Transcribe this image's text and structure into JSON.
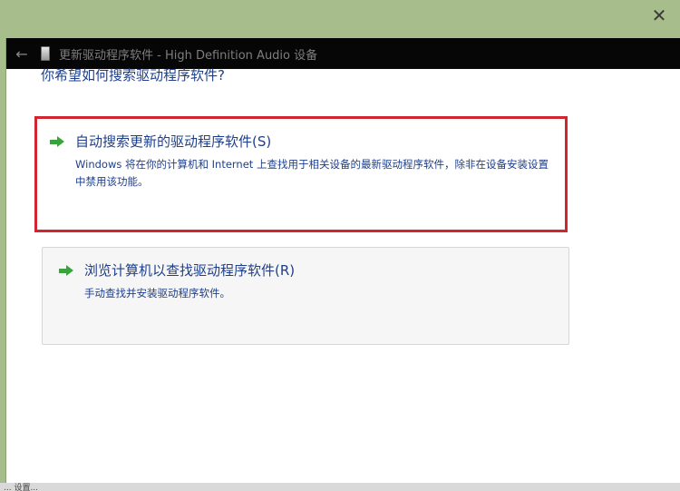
{
  "window": {
    "close_glyph": "✕",
    "back_glyph": "←",
    "title": "更新驱动程序软件 - High Definition Audio 设备"
  },
  "page": {
    "question": "你希望如何搜索驱动程序软件?"
  },
  "options": [
    {
      "title": "自动搜索更新的驱动程序软件(S)",
      "description": "Windows 将在你的计算机和 Internet 上查找用于相关设备的最新驱动程序软件，除非在设备安装设置中禁用该功能。",
      "highlighted": true,
      "highlight_color": "#d12631"
    },
    {
      "title": "浏览计算机以查找驱动程序软件(R)",
      "description": "手动查找并安装驱动程序软件。",
      "highlighted": false
    }
  ],
  "statusbar": {
    "text": "... 设置..."
  },
  "colors": {
    "accent_text": "#1e3f8c",
    "arrow": "#37a53b",
    "titlebar": "#060606",
    "desktop": "#a7be8c"
  },
  "icons": {
    "close": "close-icon",
    "back": "back-arrow-icon",
    "device": "device-icon",
    "option_arrow": "green-arrow-icon"
  }
}
